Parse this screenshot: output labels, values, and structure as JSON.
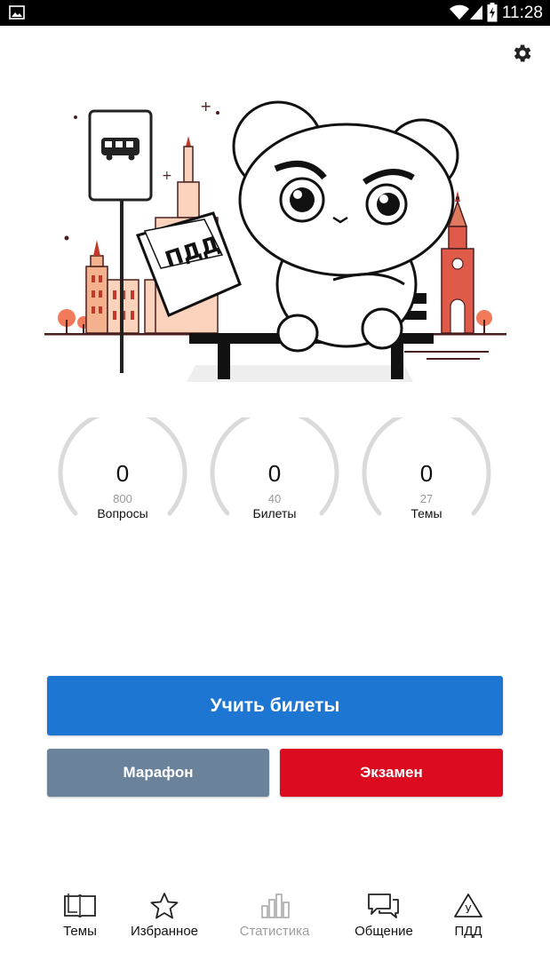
{
  "status_bar": {
    "time": "11:28"
  },
  "hero": {
    "sign_text": "ПДД"
  },
  "stats": [
    {
      "value": "0",
      "total": "800",
      "label": "Вопросы"
    },
    {
      "value": "0",
      "total": "40",
      "label": "Билеты"
    },
    {
      "value": "0",
      "total": "27",
      "label": "Темы"
    }
  ],
  "buttons": {
    "learn": "Учить билеты",
    "marathon": "Марафон",
    "exam": "Экзамен"
  },
  "nav": [
    {
      "label": "Темы",
      "icon": "book-icon"
    },
    {
      "label": "Избранное",
      "icon": "star-icon"
    },
    {
      "label": "Статистика",
      "icon": "bar-chart-icon"
    },
    {
      "label": "Общение",
      "icon": "chat-icon"
    },
    {
      "label": "ПДД",
      "icon": "road-sign-icon",
      "icon_letter": "У"
    }
  ],
  "colors": {
    "primary": "#1c76d2",
    "marathon": "#6b829b",
    "exam": "#dc0b1f",
    "accent": "#d9534f"
  }
}
